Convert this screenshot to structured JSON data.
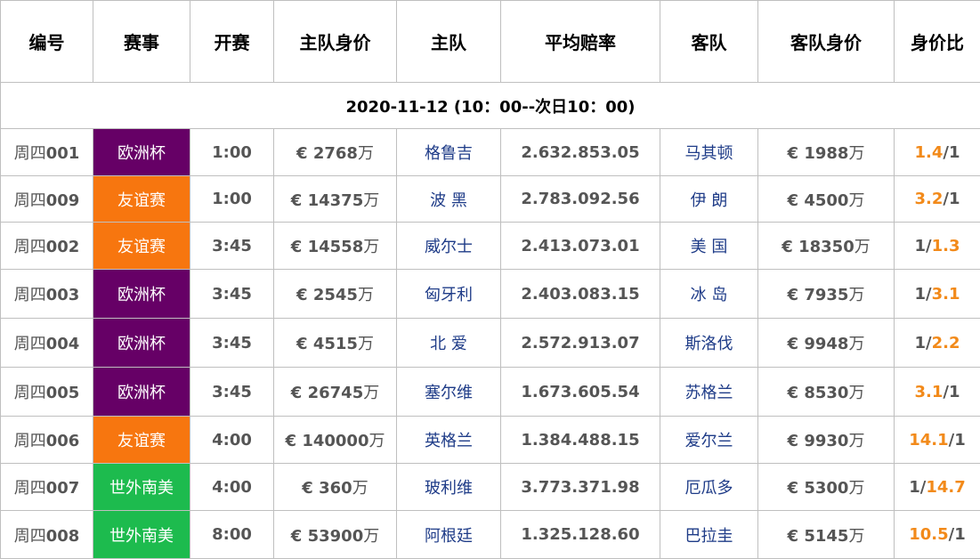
{
  "headers": [
    "编号",
    "赛事",
    "开赛",
    "主队身价",
    "主队",
    "平均赔率",
    "客队",
    "客队身价",
    "身价比"
  ],
  "date_label": "2020-11-12 (10：00--次日10：00)",
  "currency": "€",
  "unit": "万",
  "league_colors": {
    "欧洲杯": "#660066",
    "友谊赛": "#f7760f",
    "世外南美": "#1dbb4e"
  },
  "highlight_color": "#f28a1a",
  "matches": [
    {
      "num_prefix": "周四",
      "num": "001",
      "league": "欧洲杯",
      "time": "1:00",
      "home_value": "2768",
      "home": "格鲁吉",
      "odds": "2.632.853.05",
      "away": "马其顿",
      "away_value": "1988",
      "ratio_left": "1.4",
      "ratio_sep": "/",
      "ratio_right": "1",
      "ratio_hl": "left"
    },
    {
      "num_prefix": "周四",
      "num": "009",
      "league": "友谊赛",
      "time": "1:00",
      "home_value": "14375",
      "home": "波 黑",
      "odds": "2.783.092.56",
      "away": "伊 朗",
      "away_value": "4500",
      "ratio_left": "3.2",
      "ratio_sep": "/",
      "ratio_right": "1",
      "ratio_hl": "left"
    },
    {
      "num_prefix": "周四",
      "num": "002",
      "league": "友谊赛",
      "time": "3:45",
      "home_value": "14558",
      "home": "威尔士",
      "odds": "2.413.073.01",
      "away": "美 国",
      "away_value": "18350",
      "ratio_left": "1",
      "ratio_sep": "/",
      "ratio_right": "1.3",
      "ratio_hl": "right"
    },
    {
      "num_prefix": "周四",
      "num": "003",
      "league": "欧洲杯",
      "time": "3:45",
      "home_value": "2545",
      "home": "匈牙利",
      "odds": "2.403.083.15",
      "away": "冰 岛",
      "away_value": "7935",
      "ratio_left": "1",
      "ratio_sep": "/",
      "ratio_right": "3.1",
      "ratio_hl": "right"
    },
    {
      "num_prefix": "周四",
      "num": "004",
      "league": "欧洲杯",
      "time": "3:45",
      "home_value": "4515",
      "home": "北 爱",
      "odds": "2.572.913.07",
      "away": "斯洛伐",
      "away_value": "9948",
      "ratio_left": "1",
      "ratio_sep": "/",
      "ratio_right": "2.2",
      "ratio_hl": "right"
    },
    {
      "num_prefix": "周四",
      "num": "005",
      "league": "欧洲杯",
      "time": "3:45",
      "home_value": "26745",
      "home": "塞尔维",
      "odds": "1.673.605.54",
      "away": "苏格兰",
      "away_value": "8530",
      "ratio_left": "3.1",
      "ratio_sep": "/",
      "ratio_right": "1",
      "ratio_hl": "left"
    },
    {
      "num_prefix": "周四",
      "num": "006",
      "league": "友谊赛",
      "time": "4:00",
      "home_value": "140000",
      "home": "英格兰",
      "odds": "1.384.488.15",
      "away": "爱尔兰",
      "away_value": "9930",
      "ratio_left": "14.1",
      "ratio_sep": "/",
      "ratio_right": "1",
      "ratio_hl": "left"
    },
    {
      "num_prefix": "周四",
      "num": "007",
      "league": "世外南美",
      "time": "4:00",
      "home_value": "360",
      "home": "玻利维",
      "odds": "3.773.371.98",
      "away": "厄瓜多",
      "away_value": "5300",
      "ratio_left": "1",
      "ratio_sep": "/",
      "ratio_right": "14.7",
      "ratio_hl": "right"
    },
    {
      "num_prefix": "周四",
      "num": "008",
      "league": "世外南美",
      "time": "8:00",
      "home_value": "53900",
      "home": "阿根廷",
      "odds": "1.325.128.60",
      "away": "巴拉圭",
      "away_value": "5145",
      "ratio_left": "10.5",
      "ratio_sep": "/",
      "ratio_right": "1",
      "ratio_hl": "left"
    }
  ]
}
